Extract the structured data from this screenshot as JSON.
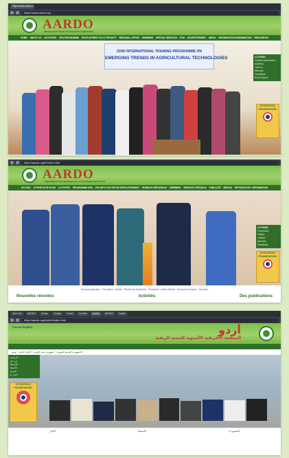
{
  "screens": [
    {
      "tabs": [],
      "url": "https://www.aardo.org",
      "brand": "AARDO",
      "brand_sub": "African-Asian Rural Development Organization",
      "nav": [
        "HOME",
        "ABOUT US",
        "ACTIVITIES",
        "CRD PROGRAMME",
        "DEVELOPMENT PILOT PROJECT",
        "REGIONAL OFFICE",
        "MEMBERS",
        "SPECIAL SERVICES",
        "RTM",
        "ADVERTISEMENT",
        "MEDIA",
        "INFORMATION DISSEMINATION",
        "RESOURCES",
        "AARDO-PEDIA"
      ],
      "banner_line1": "22ND INTERNATIONAL TRAINING PROGRAMME ON",
      "banner_line2": "EMERGING TRENDS IN AGRICULTURAL TECHNOLOGIES",
      "sidebar_title": "e-FORMS",
      "sidebar_links": [
        "Contact Information",
        "Address",
        "Join Us",
        "Member",
        "Feedback",
        "Email Query"
      ],
      "strategic_label": "STRATEGIC FRAMEWORK"
    },
    {
      "url": "https://aardo.org/fr/index.html",
      "brand": "AARDO",
      "brand_sub": "Organisation Afro-Asiatique pour le Développement Rural",
      "nav": [
        "ACCUEIL",
        "À PROPOS DE NOUS",
        "ACTIVITÉS",
        "PROGRAMME DRA",
        "PROJETS PILOTES DE DÉVELOPPEMENT",
        "BUREAUX RÉGIONAUX",
        "MEMBRES",
        "SERVICES SPÉCIAUX",
        "PUBLICITÉ",
        "MÉDIAS",
        "DIFFUSION DE L'INFORMATION"
      ],
      "sidebar_title": "e-FORMS",
      "sidebar_links": [
        "Formulaire",
        "Visites",
        "Joindre",
        "Membre",
        "Feedback"
      ],
      "strategic_label": "STRATEGIC FRAMEWORK",
      "caption": "Services spéciaux · Formation · Atelier · Études de recherche · Réunions / Visite d'étude · Services d'experts · Services",
      "sections": [
        "Nouvelles récentes",
        "Activités",
        "Des publications"
      ]
    },
    {
      "tabs": [
        "New Tab",
        "AARDO",
        "Arabic",
        "Google",
        "Home",
        "Contact",
        "Arabic",
        "AARDO",
        "Arabic",
        "Login"
      ],
      "url": "https://aardo.org/Arabic/index.html",
      "lang_links": "French English",
      "arabic_title": "أردو",
      "arabic_sub": "المنظمة الأفريقية الآسيوية للتنمية الريفية",
      "ticker": "الجمهورية العربية السورية  ·  جمهورية مصر العربية  ·  الأمانة العامة  ·  تونس",
      "sidebar_links": [
        "الرئيسية",
        "من نحن",
        "الأنشطة",
        "الأعضاء",
        "الموارد",
        "اتصل بنا"
      ],
      "strategic_label": "STRATEGIC FRAMEWORK",
      "footer": [
        "الأخبار",
        "الأنشطة",
        "المنشورات"
      ]
    }
  ],
  "colors": {
    "header_green": "#7cc04b",
    "nav_green": "#2f6f2a",
    "brand_red": "#c0392b",
    "chrome_dark": "#2b2f36"
  },
  "icons": [
    "aardo-logo-icon",
    "strategic-eye-icon",
    "browser-back-icon",
    "browser-reload-icon"
  ]
}
